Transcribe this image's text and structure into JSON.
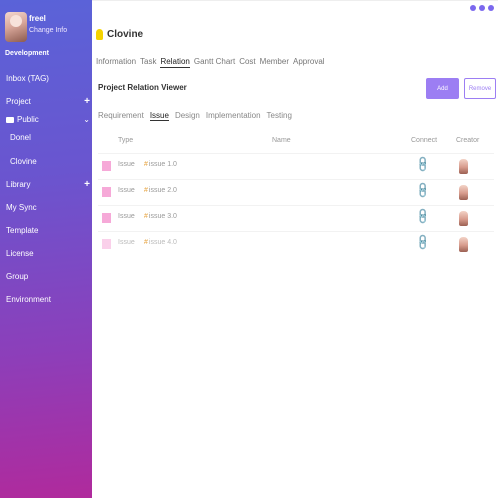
{
  "window": {
    "controls": [
      "minimize-icon",
      "maximize-icon",
      "close-icon"
    ],
    "accent": "#7b68ee"
  },
  "sidebar": {
    "gradient": [
      "#5a63d8",
      "#b02a9c"
    ],
    "user": {
      "name": "freel",
      "status": "Change Info",
      "role": "Development"
    },
    "items": [
      {
        "label": "Inbox (TAG)"
      },
      {
        "label": "Project"
      },
      {
        "label": "Public"
      },
      {
        "label": "Donel"
      },
      {
        "label": "Clovine"
      },
      {
        "label": "Library"
      },
      {
        "label": "My Sync"
      },
      {
        "label": "Template"
      },
      {
        "label": "License"
      },
      {
        "label": "Group"
      },
      {
        "label": "Environment"
      }
    ]
  },
  "project": {
    "name": "Clovine",
    "tabs": [
      "Information",
      "Task",
      "Relation",
      "Gantt Chart",
      "Cost",
      "Member",
      "Approval"
    ],
    "active_tab": "Relation"
  },
  "viewer": {
    "title": "Project Relation Viewer",
    "add_label": "Add",
    "remove_label": "Remove",
    "accent": "#9c7ef3",
    "subtabs": [
      "Requirement",
      "Issue",
      "Design",
      "Implementation",
      "Testing"
    ],
    "active_subtab": "Issue"
  },
  "table": {
    "columns": {
      "type": "Type",
      "name": "Name",
      "connect": "Connect",
      "creator": "Creator"
    },
    "rows": [
      {
        "type": "Issue",
        "name": "issue 1.0",
        "connected": true
      },
      {
        "type": "Issue",
        "name": "issue 2.0",
        "connected": true
      },
      {
        "type": "Issue",
        "name": "issue 3.0",
        "connected": true
      },
      {
        "type": "Issue",
        "name": "issue 4.0",
        "connected": false
      }
    ],
    "swatch_color": "#f6a9d8",
    "connect_icon": "link-icon",
    "connect_color": "#2d8cf0"
  }
}
